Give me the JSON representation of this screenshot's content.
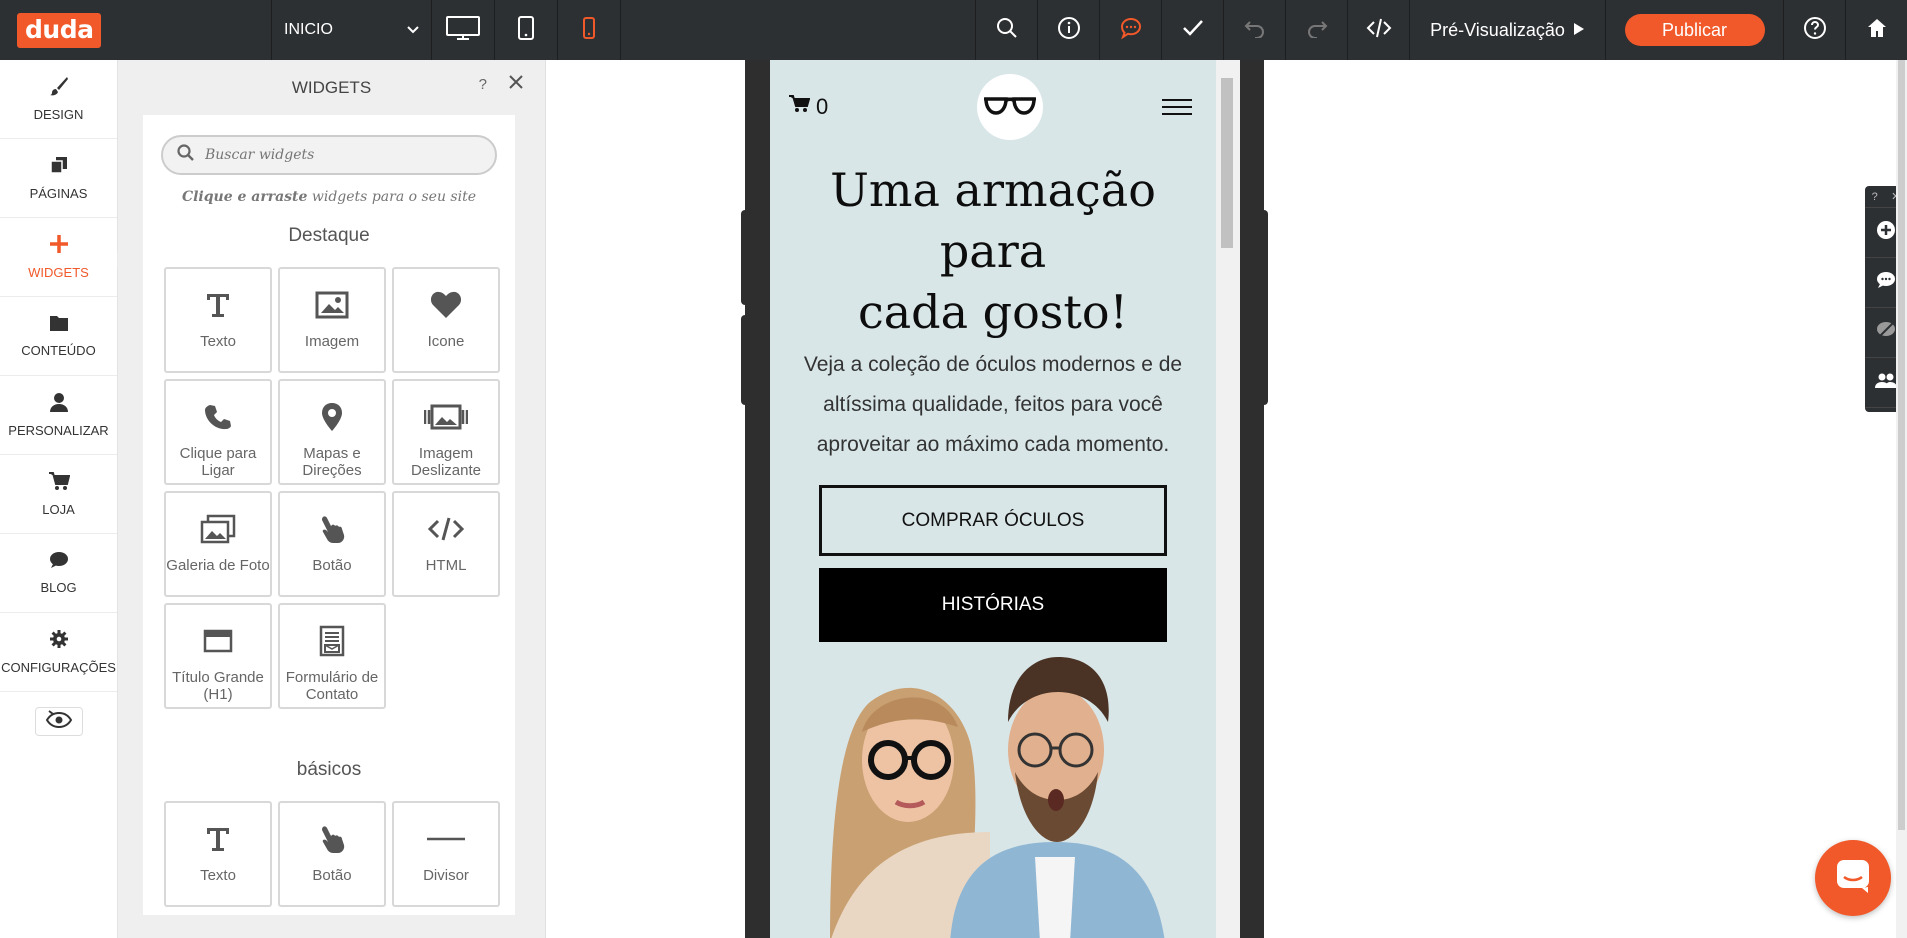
{
  "topbar": {
    "logo": "duda",
    "page_selector": "INICIO",
    "preview_label": "Pré-Visualização",
    "publish_label": "Publicar",
    "icons": [
      "desktop-icon",
      "tablet-icon",
      "mobile-icon",
      "search-icon",
      "info-icon",
      "comment-icon",
      "check-icon",
      "undo-icon",
      "redo-icon",
      "code-icon",
      "help-icon",
      "home-icon"
    ],
    "accent": "#f1592a",
    "bg": "#2d3033"
  },
  "leftnav": {
    "items": [
      {
        "label": "DESIGN",
        "icon": "brush-icon"
      },
      {
        "label": "PÁGINAS",
        "icon": "pages-icon"
      },
      {
        "label": "WIDGETS",
        "icon": "plus-icon",
        "active": true
      },
      {
        "label": "CONTEÚDO",
        "icon": "folder-icon"
      },
      {
        "label": "PERSONALIZAR",
        "icon": "person-icon"
      },
      {
        "label": "LOJA",
        "icon": "cart-icon"
      },
      {
        "label": "BLOG",
        "icon": "chat-bubble-icon"
      },
      {
        "label": "CONFIGURAÇÕES",
        "icon": "gear-icon"
      }
    ]
  },
  "panel": {
    "title": "WIDGETS",
    "help": "?",
    "search_placeholder": "Buscar widgets",
    "hint_bold": "Clique e arraste",
    "hint_rest": " widgets para o seu site",
    "featured_title": "Destaque",
    "featured": [
      {
        "label": "Texto",
        "icon": "text-icon"
      },
      {
        "label": "Imagem",
        "icon": "image-icon"
      },
      {
        "label": "Icone",
        "icon": "heart-icon"
      },
      {
        "label": "Clique para Ligar",
        "icon": "phone-icon"
      },
      {
        "label": "Mapas e Direções",
        "icon": "map-pin-icon"
      },
      {
        "label": "Imagem Deslizante",
        "icon": "slider-icon"
      },
      {
        "label": "Galeria de Foto",
        "icon": "gallery-icon"
      },
      {
        "label": "Botão",
        "icon": "pointer-icon"
      },
      {
        "label": "HTML",
        "icon": "html-icon"
      },
      {
        "label": "Título Grande (H1)",
        "icon": "title-icon"
      },
      {
        "label": "Formulário de Contato",
        "icon": "form-icon"
      }
    ],
    "basic_title": "básicos",
    "basic": [
      {
        "label": "Texto",
        "icon": "text-icon"
      },
      {
        "label": "Botão",
        "icon": "pointer-icon"
      },
      {
        "label": "Divisor",
        "icon": "divider-icon"
      }
    ]
  },
  "site": {
    "cart_count": "0",
    "hero_title": "Uma armação\npara\ncada gosto!",
    "hero_text": "Veja a coleção de óculos modernos e de altíssima qualidade, feitos para você aproveitar ao máximo cada momento.",
    "btn_primary": "COMPRAR ÓCULOS",
    "btn_secondary": "HISTÓRIAS",
    "bg_color": "#d9e6e8"
  },
  "floattool": {
    "help": "?",
    "close": "✕"
  }
}
